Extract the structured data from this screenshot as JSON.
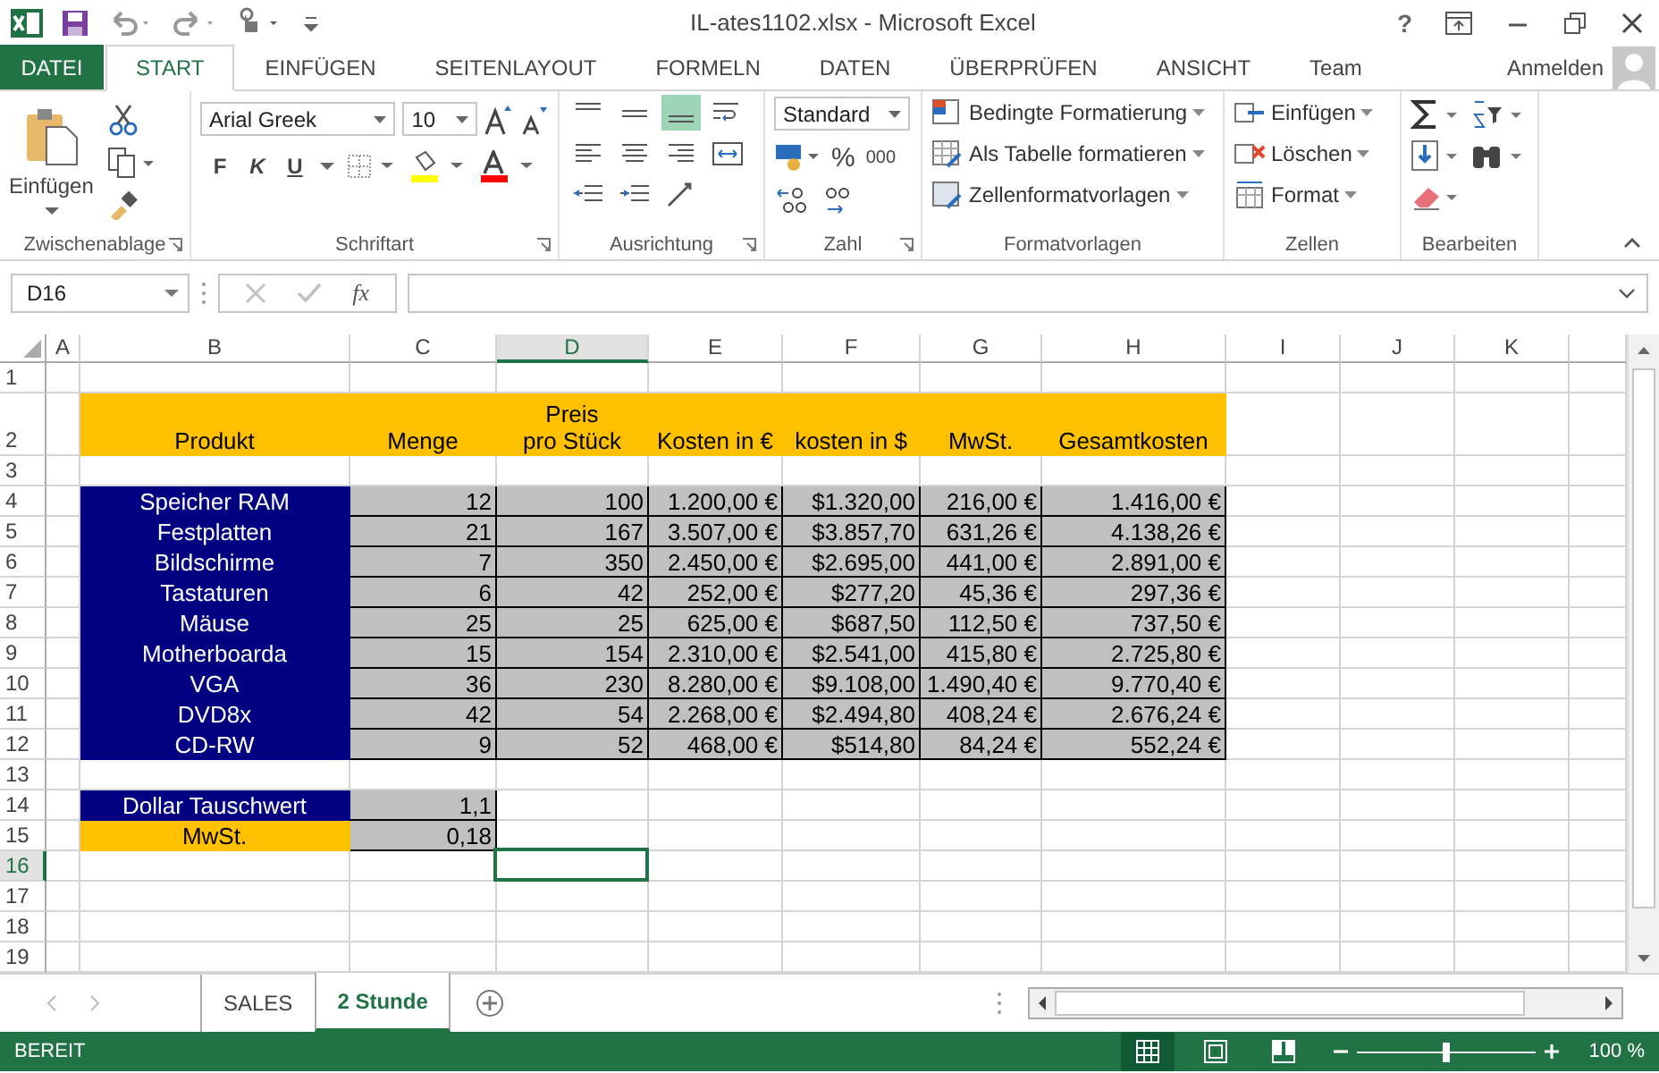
{
  "window": {
    "title": "IL-ates1102.xlsx - Microsoft Excel",
    "help": "?"
  },
  "tabs": [
    {
      "label": "DATEI",
      "kind": "file",
      "selected": false
    },
    {
      "label": "START",
      "kind": "tab",
      "selected": true
    },
    {
      "label": "EINFÜGEN",
      "kind": "tab",
      "selected": false
    },
    {
      "label": "SEITENLAYOUT",
      "kind": "tab",
      "selected": false
    },
    {
      "label": "FORMELN",
      "kind": "tab",
      "selected": false
    },
    {
      "label": "DATEN",
      "kind": "tab",
      "selected": false
    },
    {
      "label": "ÜBERPRÜFEN",
      "kind": "tab",
      "selected": false
    },
    {
      "label": "ANSICHT",
      "kind": "tab",
      "selected": false
    },
    {
      "label": "Team",
      "kind": "tab",
      "selected": false
    }
  ],
  "account": "Anmelden",
  "ribbon": {
    "clipboard": {
      "label": "Zwischenablage",
      "paste": "Einfügen"
    },
    "font": {
      "label": "Schriftart",
      "name": "Arial Greek",
      "size": "10",
      "bold": "F",
      "italic": "K",
      "underline": "U"
    },
    "alignment": {
      "label": "Ausrichtung",
      "buttons": [
        {
          "kind": "top",
          "selected": false
        },
        {
          "kind": "middle",
          "selected": false
        },
        {
          "kind": "bottom",
          "selected": true
        },
        {
          "kind": "wrap",
          "selected": false
        },
        {
          "kind": "left",
          "selected": false
        },
        {
          "kind": "center",
          "selected": false
        },
        {
          "kind": "right",
          "selected": false
        },
        {
          "kind": "merge",
          "selected": false
        },
        {
          "kind": "outdent",
          "selected": false
        },
        {
          "kind": "indent",
          "selected": false
        },
        {
          "kind": "orientation",
          "selected": false
        }
      ]
    },
    "number": {
      "label": "Zahl",
      "format": "Standard",
      "percent": "%",
      "thousands": "000"
    },
    "styles": {
      "label": "Formatvorlagen",
      "items": [
        "Bedingte Formatierung",
        "Als Tabelle formatieren",
        "Zellenformatvorlagen"
      ]
    },
    "cells": {
      "label": "Zellen",
      "items": [
        "Einfügen",
        "Löschen",
        "Format"
      ]
    },
    "editing": {
      "label": "Bearbeiten"
    }
  },
  "formula_bar": {
    "name_box": "D16",
    "function_label": "fx"
  },
  "grid": {
    "columns": [
      {
        "label": "A",
        "selected": false
      },
      {
        "label": "B",
        "selected": false
      },
      {
        "label": "C",
        "selected": false
      },
      {
        "label": "D",
        "selected": true
      },
      {
        "label": "E",
        "selected": false
      },
      {
        "label": "F",
        "selected": false
      },
      {
        "label": "G",
        "selected": false
      },
      {
        "label": "H",
        "selected": false
      },
      {
        "label": "I",
        "selected": false
      },
      {
        "label": "J",
        "selected": false
      },
      {
        "label": "K",
        "selected": false
      }
    ],
    "rows": [
      {
        "number": "1",
        "kind": "blank",
        "selected": false
      },
      {
        "number": "2",
        "kind": "header",
        "selected": false,
        "cells": [
          "Produkt",
          "Menge",
          "Preis\npro Stück",
          "Kosten in €",
          "kosten in $",
          "MwSt.",
          "Gesamtkosten"
        ]
      },
      {
        "number": "3",
        "kind": "blank",
        "selected": false
      },
      {
        "number": "4",
        "kind": "item",
        "selected": false,
        "cells": [
          "Speicher RAM",
          "12",
          "100",
          "1.200,00 €",
          "$1.320,00",
          "216,00 €",
          "1.416,00 €"
        ]
      },
      {
        "number": "5",
        "kind": "item",
        "selected": false,
        "cells": [
          "Festplatten",
          "21",
          "167",
          "3.507,00 €",
          "$3.857,70",
          "631,26 €",
          "4.138,26 €"
        ]
      },
      {
        "number": "6",
        "kind": "item",
        "selected": false,
        "cells": [
          "Bildschirme",
          "7",
          "350",
          "2.450,00 €",
          "$2.695,00",
          "441,00 €",
          "2.891,00 €"
        ]
      },
      {
        "number": "7",
        "kind": "item",
        "selected": false,
        "cells": [
          "Tastaturen",
          "6",
          "42",
          "252,00 €",
          "$277,20",
          "45,36 €",
          "297,36 €"
        ]
      },
      {
        "number": "8",
        "kind": "item",
        "selected": false,
        "cells": [
          "Mäuse",
          "25",
          "25",
          "625,00 €",
          "$687,50",
          "112,50 €",
          "737,50 €"
        ]
      },
      {
        "number": "9",
        "kind": "item",
        "selected": false,
        "cells": [
          "Motherboarda",
          "15",
          "154",
          "2.310,00 €",
          "$2.541,00",
          "415,80 €",
          "2.725,80 €"
        ]
      },
      {
        "number": "10",
        "kind": "item",
        "selected": false,
        "cells": [
          "VGA",
          "36",
          "230",
          "8.280,00 €",
          "$9.108,00",
          "1.490,40 €",
          "9.770,40 €"
        ]
      },
      {
        "number": "11",
        "kind": "item",
        "selected": false,
        "cells": [
          "DVD8x",
          "42",
          "54",
          "2.268,00 €",
          "$2.494,80",
          "408,24 €",
          "2.676,24 €"
        ]
      },
      {
        "number": "12",
        "kind": "item",
        "selected": false,
        "cells": [
          "CD-RW",
          "9",
          "52",
          "468,00 €",
          "$514,80",
          "84,24 €",
          "552,24 €"
        ]
      },
      {
        "number": "13",
        "kind": "blank",
        "selected": false
      },
      {
        "number": "14",
        "kind": "param",
        "selected": false,
        "label": "Dollar Tauschwert",
        "value": "1,1",
        "color": "#000080"
      },
      {
        "number": "15",
        "kind": "param",
        "selected": false,
        "label": "MwSt.",
        "value": "0,18",
        "color": "#ffc000"
      },
      {
        "number": "16",
        "kind": "blank",
        "selected": true
      },
      {
        "number": "17",
        "kind": "blank",
        "selected": false
      },
      {
        "number": "18",
        "kind": "blank",
        "selected": false
      },
      {
        "number": "19",
        "kind": "blank",
        "selected": false
      }
    ]
  },
  "sheets": [
    {
      "label": "SALES",
      "selected": false
    },
    {
      "label": "2 Stunde",
      "selected": true
    }
  ],
  "status_bar": {
    "text": "BEREIT",
    "views": [
      {
        "kind": "normal",
        "selected": true
      },
      {
        "kind": "layout",
        "selected": false
      },
      {
        "kind": "pagebreak",
        "selected": false
      }
    ],
    "zoom": {
      "level": 0.5,
      "reading": "100 %"
    }
  }
}
